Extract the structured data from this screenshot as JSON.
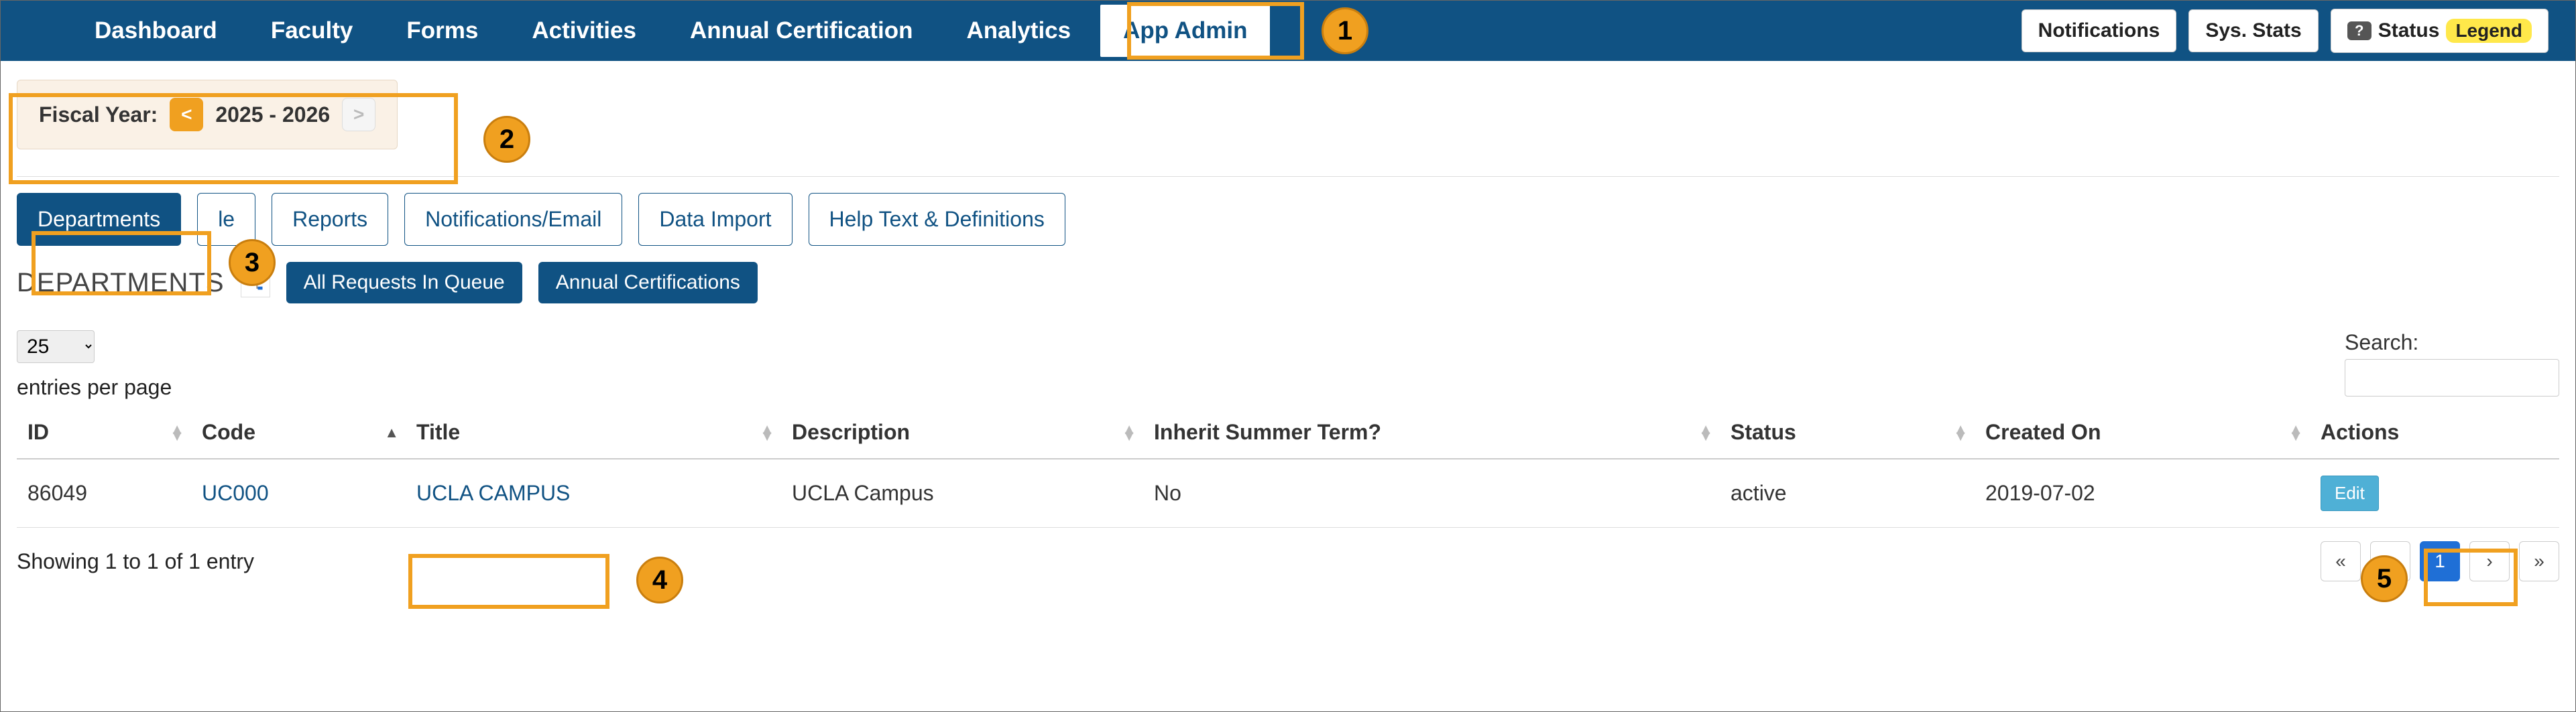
{
  "nav": {
    "items": [
      {
        "label": "Dashboard"
      },
      {
        "label": "Faculty"
      },
      {
        "label": "Forms"
      },
      {
        "label": "Activities"
      },
      {
        "label": "Annual Certification"
      },
      {
        "label": "Analytics"
      },
      {
        "label": "App Admin",
        "active": true
      }
    ],
    "right": {
      "notifications": "Notifications",
      "sysstats": "Sys. Stats",
      "status": "Status",
      "legend": "Legend"
    }
  },
  "fiscal": {
    "label": "Fiscal Year:",
    "range": "2025 - 2026",
    "prev_glyph": "<",
    "next_glyph": ">"
  },
  "admin_tabs": {
    "departments": "Departments",
    "partial_people": "le",
    "reports": "Reports",
    "notifications_email": "Notifications/Email",
    "data_import": "Data Import",
    "help_text": "Help Text & Definitions"
  },
  "section": {
    "title": "DEPARTMENTS",
    "btn_queue": "All Requests In Queue",
    "btn_annual": "Annual Certifications"
  },
  "table": {
    "page_length_value": "25",
    "page_length_label": "entries per page",
    "search_label": "Search:",
    "columns": {
      "id": "ID",
      "code": "Code",
      "title": "Title",
      "description": "Description",
      "inherit": "Inherit Summer Term?",
      "status": "Status",
      "created": "Created On",
      "actions": "Actions"
    },
    "rows": [
      {
        "id": "86049",
        "code": "UC000",
        "title": "UCLA CAMPUS",
        "description": "UCLA Campus",
        "inherit": "No",
        "status": "active",
        "created": "2019-07-02",
        "edit": "Edit"
      }
    ],
    "info": "Showing 1 to 1 of 1 entry",
    "pager": {
      "first": "«",
      "prev": "‹",
      "current": "1",
      "next": "›",
      "last": "»"
    }
  },
  "callouts": {
    "c1": "1",
    "c2": "2",
    "c3": "3",
    "c4": "4",
    "c5": "5"
  }
}
